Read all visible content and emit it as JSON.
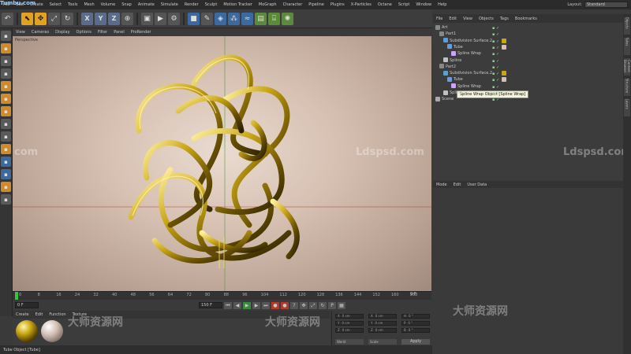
{
  "app": {
    "menu": [
      "File",
      "Edit",
      "Create",
      "Select",
      "Tools",
      "Mesh",
      "Volume",
      "Snap",
      "Animate",
      "Simulate",
      "Render",
      "Sculpt",
      "Motion Tracker",
      "MoGraph",
      "Character",
      "Pipeline",
      "Plugins",
      "X-Particles",
      "Octane",
      "Script",
      "Window",
      "Help"
    ],
    "layout_label": "Layout:",
    "layout_value": "Standard",
    "logo_text": "Tumbu.com"
  },
  "toolbar": {
    "buttons": [
      "undo-icon",
      "live-select-icon",
      "move-icon",
      "scale-icon",
      "rotate-icon",
      "x-axis",
      "y-axis",
      "z-axis",
      "coordinate-system-icon",
      "render-view-icon",
      "render-icon",
      "render-settings-icon",
      "cube-icon",
      "pen-icon",
      "subdivision-icon",
      "array-icon",
      "deformer-icon",
      "scene-icon",
      "camera-icon",
      "light-icon"
    ],
    "axis_labels": [
      "X",
      "Y",
      "Z"
    ]
  },
  "viewport": {
    "menu": [
      "View",
      "Cameras",
      "Display",
      "Options",
      "Filter",
      "Panel",
      "ProRender"
    ],
    "name": "Perspective",
    "watermarks": [
      "Ldspsd.com",
      "Ldspsd.com",
      "com",
      "Ldspsd.com"
    ]
  },
  "timeline": {
    "ticks": [
      "0",
      "8",
      "16",
      "24",
      "32",
      "40",
      "48",
      "56",
      "64",
      "72",
      "80",
      "88",
      "96",
      "104",
      "112",
      "120",
      "128",
      "136",
      "144",
      "152",
      "160",
      "168"
    ],
    "current_frame": "0 F",
    "start_field": "0 F",
    "end_field": "150 F",
    "right_field": "0 F"
  },
  "material_manager": {
    "menu": [
      "Create",
      "Edit",
      "Function",
      "Texture"
    ],
    "materials": [
      "Mat",
      "Mat.1"
    ]
  },
  "coordinates": {
    "fields": [
      "X",
      "Y",
      "Z",
      "X",
      "Y",
      "Z",
      "H",
      "P",
      "B"
    ],
    "values": [
      "0 cm",
      "0 cm",
      "0 cm",
      "0 cm",
      "0 cm",
      "0 cm",
      "0 °",
      "0 °",
      "0 °"
    ],
    "mode": "World",
    "size_mode": "Scale",
    "apply_label": "Apply"
  },
  "status": {
    "text": "Tube Object [Tube]"
  },
  "object_manager": {
    "menu": [
      "File",
      "Edit",
      "View",
      "Objects",
      "Tags",
      "Bookmarks"
    ],
    "rows": [
      {
        "label": "Art",
        "indent": 0,
        "icon": "null"
      },
      {
        "label": "Part1",
        "indent": 1,
        "icon": "null"
      },
      {
        "label": "Subdivision Surface.2",
        "indent": 2,
        "icon": "sub"
      },
      {
        "label": "Tube",
        "indent": 3,
        "icon": "tube"
      },
      {
        "label": "Spline Wrap",
        "indent": 4,
        "icon": "wrap"
      },
      {
        "label": "Spline",
        "indent": 2,
        "icon": "spl"
      },
      {
        "label": "Part2",
        "indent": 1,
        "icon": "null"
      },
      {
        "label": "Subdivision Surface.2",
        "indent": 2,
        "icon": "sub"
      },
      {
        "label": "Tube",
        "indent": 3,
        "icon": "tube"
      },
      {
        "label": "Spline Wrap",
        "indent": 4,
        "icon": "wrap"
      },
      {
        "label": "Spline",
        "indent": 2,
        "icon": "spl"
      },
      {
        "label": "Scene",
        "indent": 0,
        "icon": "scn"
      }
    ],
    "tooltip": "Spline Wrap Object [Spline Wrap]"
  },
  "attribute_manager": {
    "menu": [
      "Mode",
      "Edit",
      "User Data"
    ]
  },
  "side_tabs": [
    "Objects",
    "Takes",
    "Content Browser",
    "Structure",
    "Layers"
  ],
  "bottom_watermarks": [
    "大师资源网",
    "大师资源网",
    "大师资源网"
  ],
  "colors": {
    "accent": "#e5a11d",
    "gold": "#c9a616",
    "bg": "#3a3a3a"
  }
}
